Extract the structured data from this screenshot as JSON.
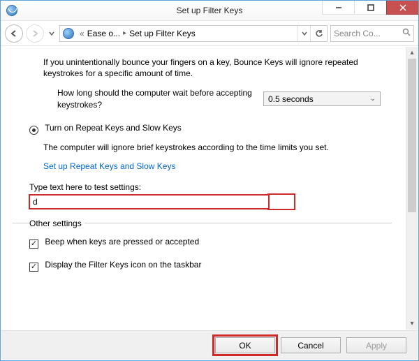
{
  "title": "Set up Filter Keys",
  "breadcrumb": {
    "prefix": "«",
    "seg1": "Ease o...",
    "seg2": "Set up Filter Keys"
  },
  "search": {
    "placeholder": "Search Co..."
  },
  "bounce": {
    "desc": "If you unintentionally bounce your fingers on a key, Bounce Keys will ignore repeated keystrokes for a specific amount of time.",
    "wait_question": "How long should the computer wait before accepting keystrokes?",
    "wait_value": "0.5 seconds"
  },
  "repeat": {
    "radio_label": "Turn on Repeat Keys and Slow Keys",
    "desc": "The computer will ignore brief keystrokes according to the time limits you set.",
    "link": "Set up Repeat Keys and Slow Keys"
  },
  "test": {
    "label": "Type text here to test settings:",
    "value": "d"
  },
  "other": {
    "legend": "Other settings",
    "beep": "Beep when keys are pressed or accepted",
    "taskbar": "Display the Filter Keys icon on the taskbar"
  },
  "buttons": {
    "ok": "OK",
    "cancel": "Cancel",
    "apply": "Apply"
  }
}
